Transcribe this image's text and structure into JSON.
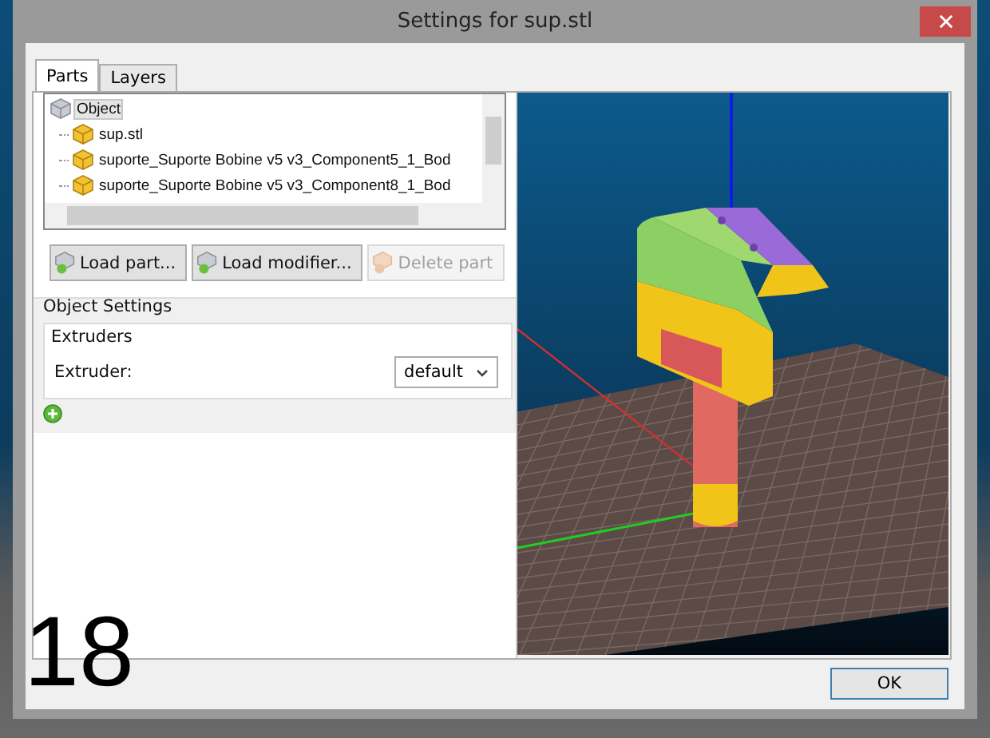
{
  "window": {
    "title": "Settings for sup.stl"
  },
  "tabs": [
    {
      "label": "Parts",
      "selected": true
    },
    {
      "label": "Layers",
      "selected": false
    }
  ],
  "parts_tree": [
    {
      "label": "Object",
      "selected": true,
      "children": [
        {
          "label": "sup.stl",
          "selected": false
        },
        {
          "label": "suporte_Suporte Bobine v5 v3_Component5_1_Bod",
          "selected": false
        },
        {
          "label": "suporte_Suporte Bobine v5 v3_Component8_1_Bod",
          "selected": false
        }
      ]
    }
  ],
  "part_buttons": [
    {
      "label": "Load part...",
      "disabled": false
    },
    {
      "label": "Load modifier...",
      "disabled": false
    },
    {
      "label": "Delete part",
      "disabled": true
    }
  ],
  "object_settings": {
    "title": "Object Settings",
    "group": {
      "title": "Extruders",
      "fields": [
        {
          "label": "Extruder:",
          "value": "default"
        }
      ]
    }
  },
  "buttons": [
    "OK"
  ],
  "step_number": "18"
}
